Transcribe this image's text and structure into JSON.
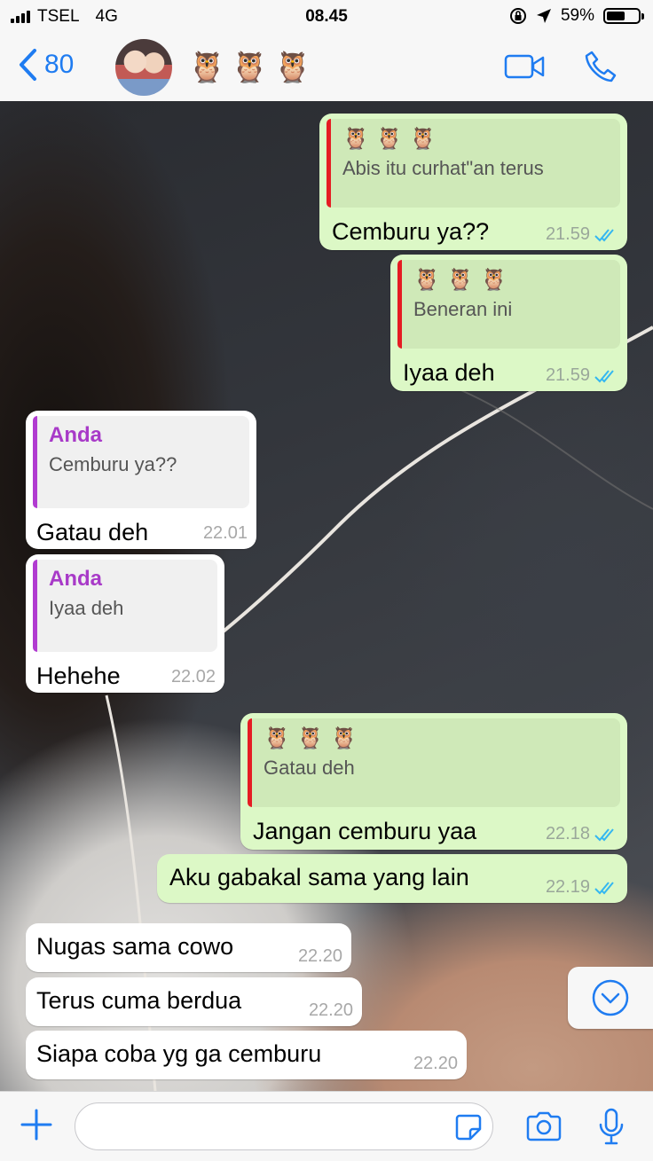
{
  "status_bar": {
    "carrier": "TSEL",
    "network": "4G",
    "time": "08.45",
    "battery": "59%",
    "battery_level": 0.59
  },
  "header": {
    "back_count": "80",
    "contact_name": "🦉🦉🦉",
    "icons": [
      "back-chevron-icon",
      "video-call-icon",
      "phone-icon"
    ]
  },
  "messages": [
    {
      "dir": "out",
      "quote": {
        "author": "🦉🦉🦉",
        "text": "Abis itu curhat\"an terus"
      },
      "text": "Cemburu ya??",
      "time": "21.59"
    },
    {
      "dir": "out",
      "quote": {
        "author": "🦉🦉🦉",
        "text": "Beneran ini"
      },
      "text": "Iyaa deh",
      "time": "21.59"
    },
    {
      "dir": "in",
      "quote": {
        "author": "Anda",
        "text": "Cemburu ya??"
      },
      "text": "Gatau deh",
      "time": "22.01"
    },
    {
      "dir": "in",
      "quote": {
        "author": "Anda",
        "text": "Iyaa deh"
      },
      "text": "Hehehe",
      "time": "22.02"
    },
    {
      "dir": "out",
      "quote": {
        "author": "🦉🦉🦉",
        "text": "Gatau deh"
      },
      "text": "Jangan cemburu yaa",
      "time": "22.18"
    },
    {
      "dir": "out",
      "text": "Aku gabakal sama yang lain",
      "time": "22.19"
    },
    {
      "dir": "in",
      "text": "Nugas sama cowo",
      "time": "22.20"
    },
    {
      "dir": "in",
      "text": "Terus cuma berdua",
      "time": "22.20"
    },
    {
      "dir": "in",
      "text": "Siapa coba yg ga cemburu",
      "time": "22.20"
    }
  ],
  "colors": {
    "accent": "#1f7cf1",
    "outgoing_bubble": "#dcf8c6",
    "incoming_bubble": "#ffffff",
    "quote_bar_out": "#e51c23",
    "quote_bar_in": "#b13bd1",
    "read_tick": "#34b7f1"
  }
}
